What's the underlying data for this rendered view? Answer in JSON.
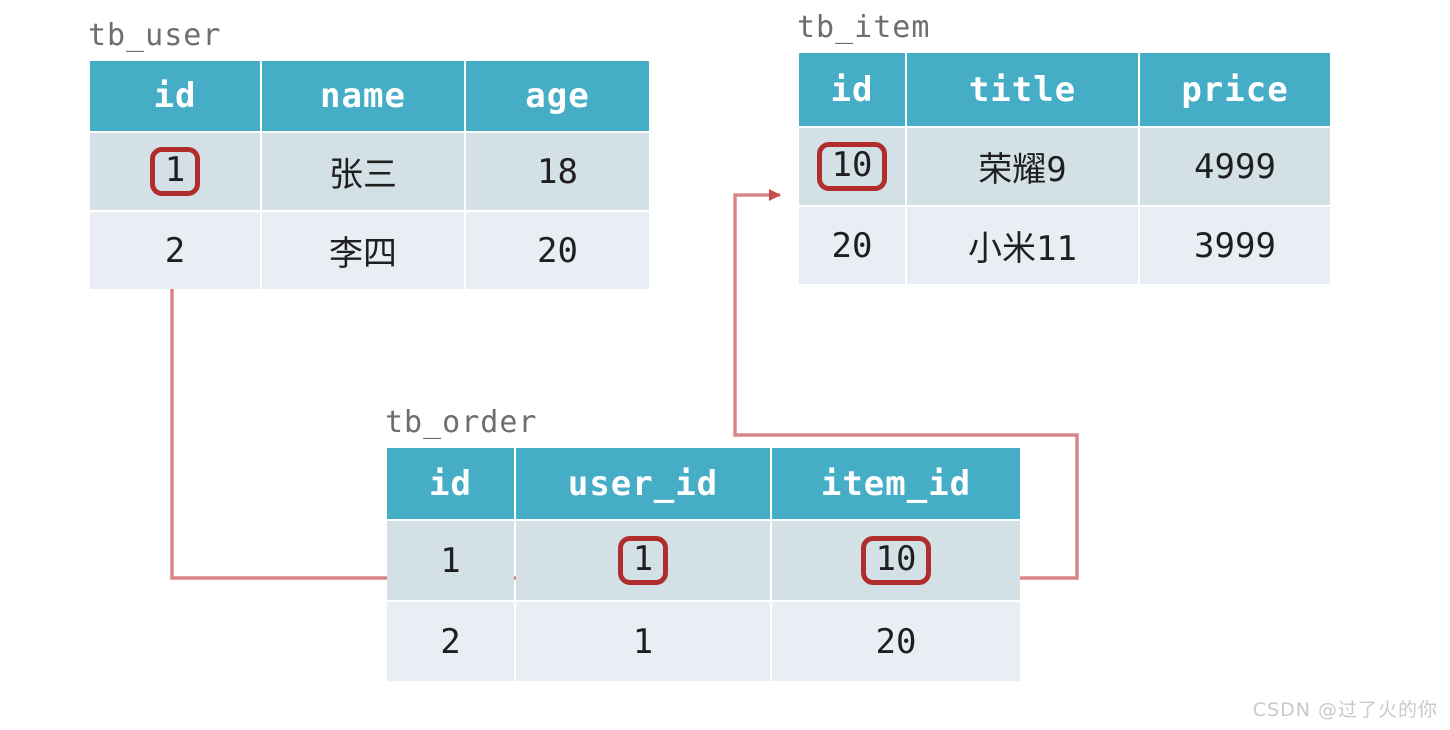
{
  "colors": {
    "header_bg": "#45adc6",
    "row_odd_bg": "#d3e0e6",
    "row_even_bg": "#e9eef4",
    "highlight_border": "#b02d2c",
    "connector_line": "#d98585",
    "arrow_head": "#c4504d",
    "title_text": "#6e6e6e",
    "cell_text": "#1f1f1f",
    "watermark_text": "#c9c9c9",
    "page_bg": "#ffffff"
  },
  "tables": {
    "user": {
      "title": "tb_user",
      "columns": [
        "id",
        "name",
        "age"
      ],
      "rows": [
        {
          "id": "1",
          "name": "张三",
          "age": "18"
        },
        {
          "id": "2",
          "name": "李四",
          "age": "20"
        }
      ]
    },
    "item": {
      "title": "tb_item",
      "columns": [
        "id",
        "title",
        "price"
      ],
      "rows": [
        {
          "id": "10",
          "title": "荣耀9",
          "price": "4999"
        },
        {
          "id": "20",
          "title": "小米11",
          "price": "3999"
        }
      ]
    },
    "order": {
      "title": "tb_order",
      "columns": [
        "id",
        "user_id",
        "item_id"
      ],
      "rows": [
        {
          "id": "1",
          "user_id": "1",
          "item_id": "10"
        },
        {
          "id": "2",
          "user_id": "1",
          "item_id": "20"
        }
      ]
    }
  },
  "relations": [
    {
      "name": "order-user-id",
      "from_table": "tb_order",
      "from_column": "user_id",
      "from_value": "1",
      "to_table": "tb_user",
      "to_column": "id",
      "to_value": "1"
    },
    {
      "name": "order-item-id",
      "from_table": "tb_order",
      "from_column": "item_id",
      "from_value": "10",
      "to_table": "tb_item",
      "to_column": "id",
      "to_value": "10"
    }
  ],
  "watermark": "CSDN @过了火的你"
}
